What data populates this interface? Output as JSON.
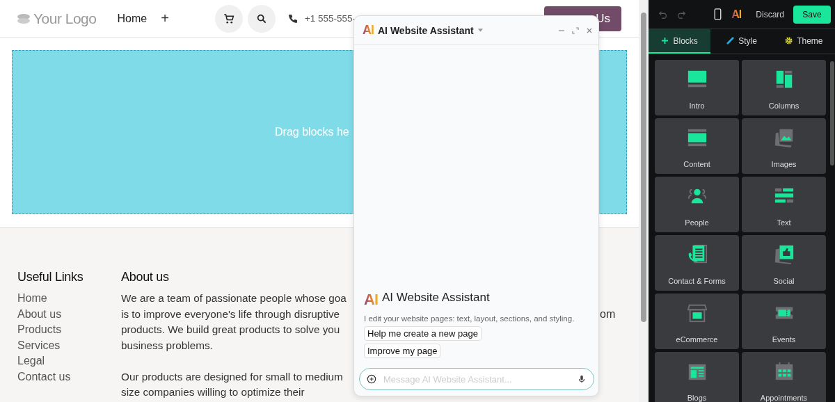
{
  "header": {
    "logo": "Your Logo",
    "nav": [
      {
        "label": "Home"
      }
    ],
    "add_label": "+",
    "phone": "+1 555-555-",
    "contact_button": "Us"
  },
  "drop_zone": {
    "text": "Drag blocks he"
  },
  "footer": {
    "links_title": "Useful Links",
    "links": [
      "Home",
      "About us",
      "Products",
      "Services",
      "Legal",
      "Contact us"
    ],
    "about_title": "About us",
    "about_lines": [
      "We are a team of passionate people whose goa",
      "is to improve everyone's life through disruptive",
      "products. We build great products to solve you",
      "business problems."
    ],
    "about_lines_2": [
      "Our products are designed for small to medium",
      "size companies willing to optimize their"
    ],
    "overflow_text": "om"
  },
  "assistant": {
    "logo": "AI",
    "title": "AI Website Assistant",
    "intro_logo": "AI",
    "intro_title": "AI Website Assistant",
    "intro_text": "I edit your website pages: text, layout, sections, and styling.",
    "suggestions": [
      "Help me create a new page",
      "Improve my page"
    ],
    "input": {
      "placeholder": "Message AI Website Assistant..."
    }
  },
  "editor": {
    "ai_label": "AI",
    "discard": "Discard",
    "save": "Save",
    "tabs": [
      {
        "label": "Blocks",
        "kind": "plus",
        "selected": true
      },
      {
        "label": "Style",
        "kind": "pencil",
        "selected": false
      },
      {
        "label": "Theme",
        "kind": "gear",
        "selected": false
      }
    ],
    "blocks": [
      {
        "label": "Intro",
        "kind": "intro"
      },
      {
        "label": "Columns",
        "kind": "columns"
      },
      {
        "label": "Content",
        "kind": "content"
      },
      {
        "label": "Images",
        "kind": "images"
      },
      {
        "label": "People",
        "kind": "people"
      },
      {
        "label": "Text",
        "kind": "text"
      },
      {
        "label": "Contact & Forms",
        "kind": "contact"
      },
      {
        "label": "Social",
        "kind": "social"
      },
      {
        "label": "eCommerce",
        "kind": "ecommerce"
      },
      {
        "label": "Events",
        "kind": "events"
      },
      {
        "label": "Blogs",
        "kind": "blogs"
      },
      {
        "label": "Appointments",
        "kind": "appointments"
      }
    ]
  }
}
